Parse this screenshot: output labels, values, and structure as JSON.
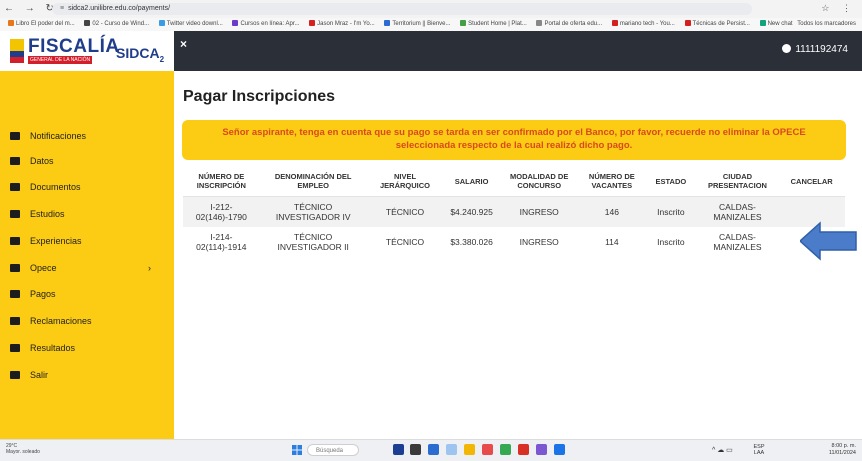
{
  "browser": {
    "url": "sidca2.unilibre.edu.co/payments/",
    "bookmarks": [
      "Libro El poder del m...",
      "02 - Curso de Wind...",
      "Twitter video downl...",
      "Cursos en línea: Apr...",
      "Jason Mraz - I'm Yo...",
      "Territorium || Bienve...",
      "Student Home | Plat...",
      "Portal de oferta edu...",
      "mariano tech - You...",
      "Técnicas de Persist...",
      "New chat"
    ],
    "all_bookmarks": "Todos los marcadores"
  },
  "header": {
    "logo_title": "FISCALÍA",
    "logo_subtitle": "GENERAL DE LA NACIÓN",
    "logo_app": "SIDCA",
    "logo_app_sub": "2",
    "close_symbol": "×",
    "user_id": "1111192474"
  },
  "sidebar": {
    "items": [
      {
        "label": "Notificaciones",
        "icon": "bell-icon"
      },
      {
        "label": "Datos",
        "icon": "data-icon"
      },
      {
        "label": "Documentos",
        "icon": "id-card-icon"
      },
      {
        "label": "Estudios",
        "icon": "graduation-cap-icon"
      },
      {
        "label": "Experiencias",
        "icon": "briefcase-icon"
      },
      {
        "label": "Opece",
        "icon": "folder-icon"
      },
      {
        "label": "Pagos",
        "icon": "credit-card-icon"
      },
      {
        "label": "Reclamaciones",
        "icon": "comment-icon"
      },
      {
        "label": "Resultados",
        "icon": "bar-chart-icon"
      },
      {
        "label": "Salir",
        "icon": "power-icon"
      }
    ],
    "opece_chevron": "›"
  },
  "main": {
    "title": "Pagar Inscripciones",
    "alert": "Señor aspirante, tenga en cuenta que su pago se tarda en ser confirmado por el Banco, por favor, recuerde no eliminar la OPECE seleccionada respecto de la cual realizó dicho pago.",
    "table": {
      "headers": [
        "NÚMERO DE INSCRIPCIÓN",
        "DENOMINACIÓN DEL EMPLEO",
        "NIVEL JERÁRQUICO",
        "SALARIO",
        "MODALIDAD DE CONCURSO",
        "NÚMERO DE VACANTES",
        "ESTADO",
        "CIUDAD PRESENTACION",
        "CANCELAR"
      ],
      "rows": [
        [
          "I-212-02(146)-1790",
          "TÉCNICO INVESTIGADOR IV",
          "TÉCNICO",
          "$4.240.925",
          "INGRESO",
          "146",
          "Inscrito",
          "CALDAS-MANIZALES",
          ""
        ],
        [
          "I-214-02(114)-1914",
          "TÉCNICO INVESTIGADOR II",
          "TÉCNICO",
          "$3.380.026",
          "INGRESO",
          "114",
          "Inscrito",
          "CALDAS-MANIZALES",
          ""
        ]
      ]
    }
  },
  "taskbar": {
    "weather_temp": "29°C",
    "weather_desc": "Mayor. soleado",
    "search_placeholder": "Búsqueda",
    "lang": "ESP LAA",
    "time": "8:00 p. m.",
    "date": "11/01/2024"
  },
  "colors": {
    "sidebar": "#fccb14",
    "header": "#2b2f38",
    "alert_text": "#d84a1b",
    "arrow": "#4a7cc9"
  }
}
